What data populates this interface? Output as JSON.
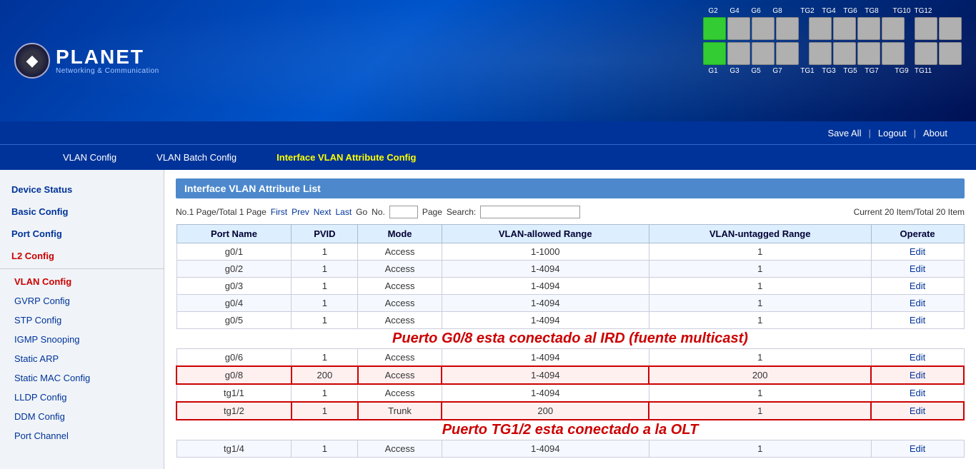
{
  "header": {
    "logo_main": "PLANET",
    "logo_sub": "Networking & Communication",
    "save_all": "Save All",
    "logout": "Logout",
    "about": "About"
  },
  "ports_top": {
    "labels": [
      "G2",
      "G4",
      "G6",
      "G8",
      "TG2",
      "TG4",
      "TG6",
      "TG8",
      "TG10",
      "TG12"
    ],
    "active": [
      0
    ]
  },
  "ports_bottom": {
    "labels": [
      "G1",
      "G3",
      "G5",
      "G7",
      "TG1",
      "TG3",
      "TG5",
      "TG7",
      "TG9",
      "TG11"
    ],
    "active": [
      0
    ]
  },
  "menu": {
    "items": [
      {
        "label": "VLAN Config",
        "active": false
      },
      {
        "label": "VLAN Batch Config",
        "active": false
      },
      {
        "label": "Interface VLAN Attribute Config",
        "active": true
      }
    ]
  },
  "sidebar": {
    "sections": [
      {
        "label": "Device Status",
        "type": "section"
      },
      {
        "label": "Basic Config",
        "type": "section"
      },
      {
        "label": "Port Config",
        "type": "section"
      },
      {
        "label": "L2 Config",
        "type": "section",
        "active": true
      },
      {
        "label": "VLAN Config",
        "type": "sub",
        "active": true
      },
      {
        "label": "GVRP Config",
        "type": "sub"
      },
      {
        "label": "STP Config",
        "type": "sub"
      },
      {
        "label": "IGMP Snooping",
        "type": "sub"
      },
      {
        "label": "Static ARP",
        "type": "sub"
      },
      {
        "label": "Static MAC Config",
        "type": "sub"
      },
      {
        "label": "LLDP Config",
        "type": "sub"
      },
      {
        "label": "DDM Config",
        "type": "sub"
      },
      {
        "label": "Port Channel",
        "type": "sub"
      }
    ]
  },
  "content": {
    "title": "Interface VLAN Attribute List",
    "pagination": {
      "info": "No.1 Page/Total 1 Page",
      "first": "First",
      "prev": "Prev",
      "next": "Next",
      "last": "Last",
      "go": "Go",
      "no_label": "No.",
      "page_label": "Page",
      "search_label": "Search:",
      "current_info": "Current 20 Item/Total 20 Item"
    },
    "table": {
      "headers": [
        "Port Name",
        "PVID",
        "Mode",
        "VLAN-allowed Range",
        "VLAN-untagged Range",
        "Operate"
      ],
      "rows": [
        {
          "port": "g0/1",
          "pvid": "1",
          "mode": "Access",
          "allowed": "1-1000",
          "untagged": "1",
          "op": "Edit"
        },
        {
          "port": "g0/2",
          "pvid": "1",
          "mode": "Access",
          "allowed": "1-4094",
          "untagged": "1",
          "op": "Edit"
        },
        {
          "port": "g0/3",
          "pvid": "1",
          "mode": "Access",
          "allowed": "1-4094",
          "untagged": "1",
          "op": "Edit"
        },
        {
          "port": "g0/4",
          "pvid": "1",
          "mode": "Access",
          "allowed": "1-4094",
          "untagged": "1",
          "op": "Edit"
        },
        {
          "port": "g0/5",
          "pvid": "1",
          "mode": "Access",
          "allowed": "1-4094",
          "untagged": "1",
          "op": "Edit"
        },
        {
          "port": "g0/6",
          "pvid": "1",
          "mode": "Access",
          "allowed": "1-4094",
          "untagged": "1",
          "op": "Edit",
          "annotation_above": "Puerto G0/8 esta conectado al IRD (fuente multicast)"
        },
        {
          "port": "g0/8",
          "pvid": "200",
          "mode": "Access",
          "allowed": "1-4094",
          "untagged": "200",
          "op": "Edit",
          "highlight": true
        },
        {
          "port": "tg1/1",
          "pvid": "1",
          "mode": "Access",
          "allowed": "1-4094",
          "untagged": "1",
          "op": "Edit"
        },
        {
          "port": "tg1/2",
          "pvid": "1",
          "mode": "Trunk",
          "allowed": "200",
          "untagged": "1",
          "op": "Edit",
          "highlight": true,
          "annotation_below": "Puerto TG1/2 esta conectado a la OLT"
        },
        {
          "port": "tg1/4",
          "pvid": "1",
          "mode": "Access",
          "allowed": "1-4094",
          "untagged": "1",
          "op": "Edit"
        }
      ]
    }
  }
}
